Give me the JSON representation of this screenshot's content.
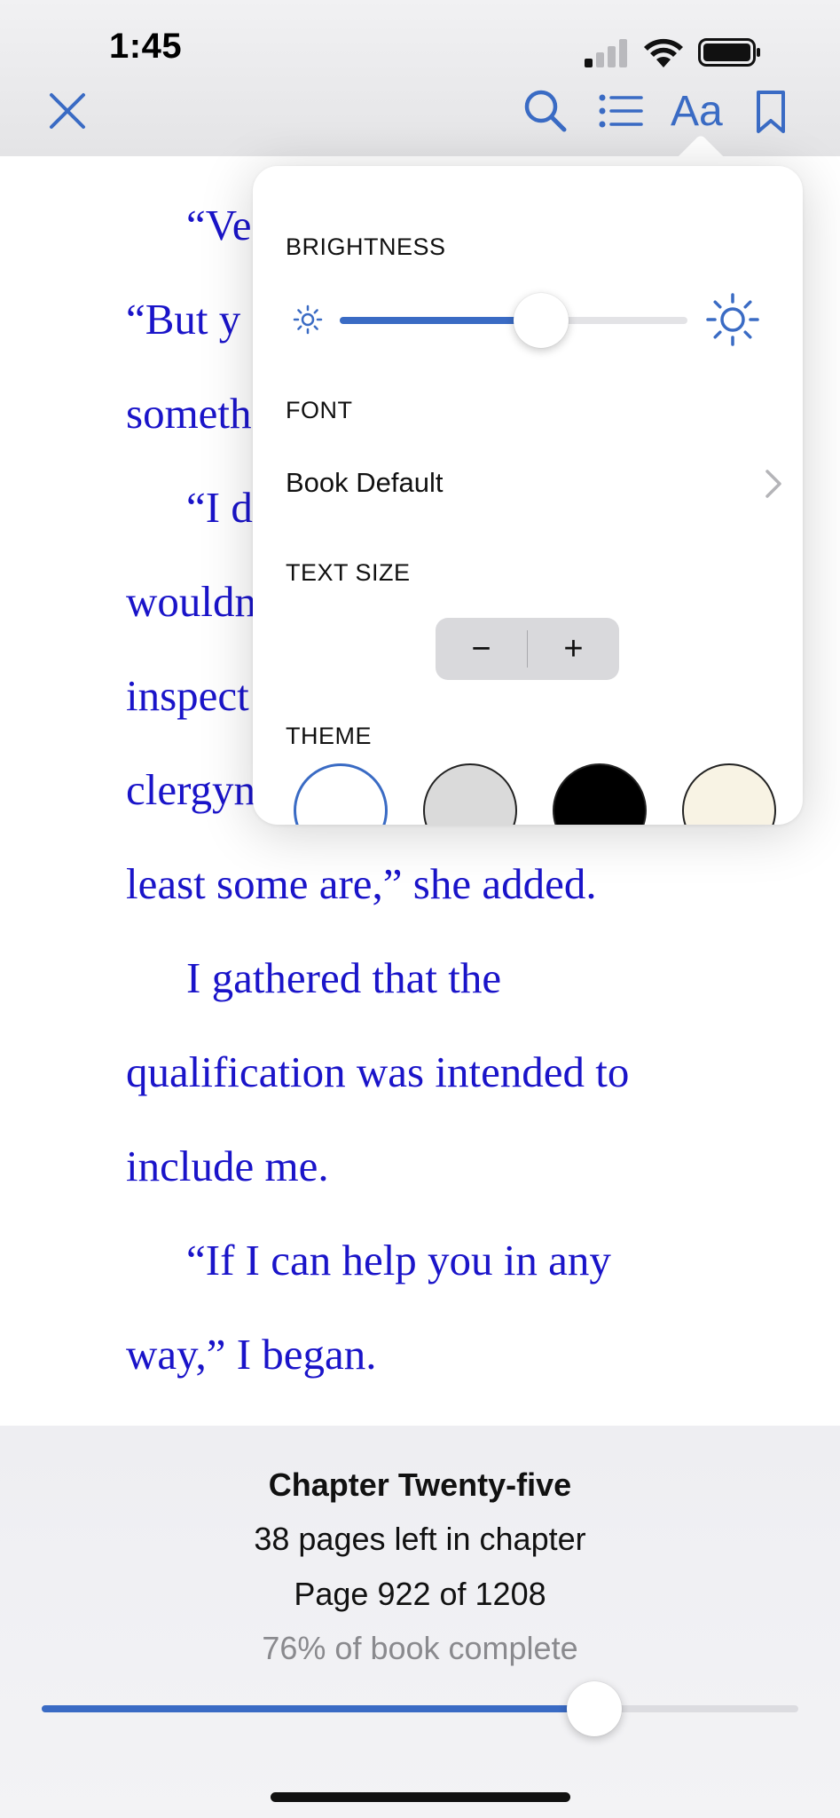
{
  "status_bar": {
    "time": "1:45"
  },
  "toolbar": {
    "icons": [
      "close-icon",
      "search-icon",
      "table-of-contents-icon",
      "text-format-icon",
      "bookmark-icon"
    ],
    "text_format_label": "Aa",
    "accent_color": "#3a6bc4"
  },
  "reader": {
    "text_color": "#1a14c9",
    "lines": [
      "“Ve",
      "“But y",
      "someth",
      "“I d",
      "wouldn",
      "inspect",
      "clergyn",
      "least some are,” she added.",
      "I gathered that the",
      "qualification was intended to",
      "include me.",
      "“If I can help you in any",
      "way,” I began."
    ]
  },
  "popover": {
    "brightness": {
      "label": "BRIGHTNESS",
      "level": 0.58
    },
    "font": {
      "label": "FONT",
      "value": "Book Default"
    },
    "text_size": {
      "label": "TEXT SIZE",
      "decrease": "−",
      "increase": "+"
    },
    "theme": {
      "label": "THEME",
      "options": [
        {
          "name": "white",
          "color": "#ffffff",
          "selected": true
        },
        {
          "name": "gray",
          "color": "#dadada",
          "selected": false
        },
        {
          "name": "black",
          "color": "#000000",
          "selected": false
        },
        {
          "name": "sepia",
          "color": "#f8f3e4",
          "selected": false
        }
      ]
    }
  },
  "footer": {
    "chapter": "Chapter Twenty-five",
    "pages_left": "38 pages left in chapter",
    "page": "Page 922 of 1208",
    "percent_complete": "76% of book complete",
    "progress": 0.73
  }
}
